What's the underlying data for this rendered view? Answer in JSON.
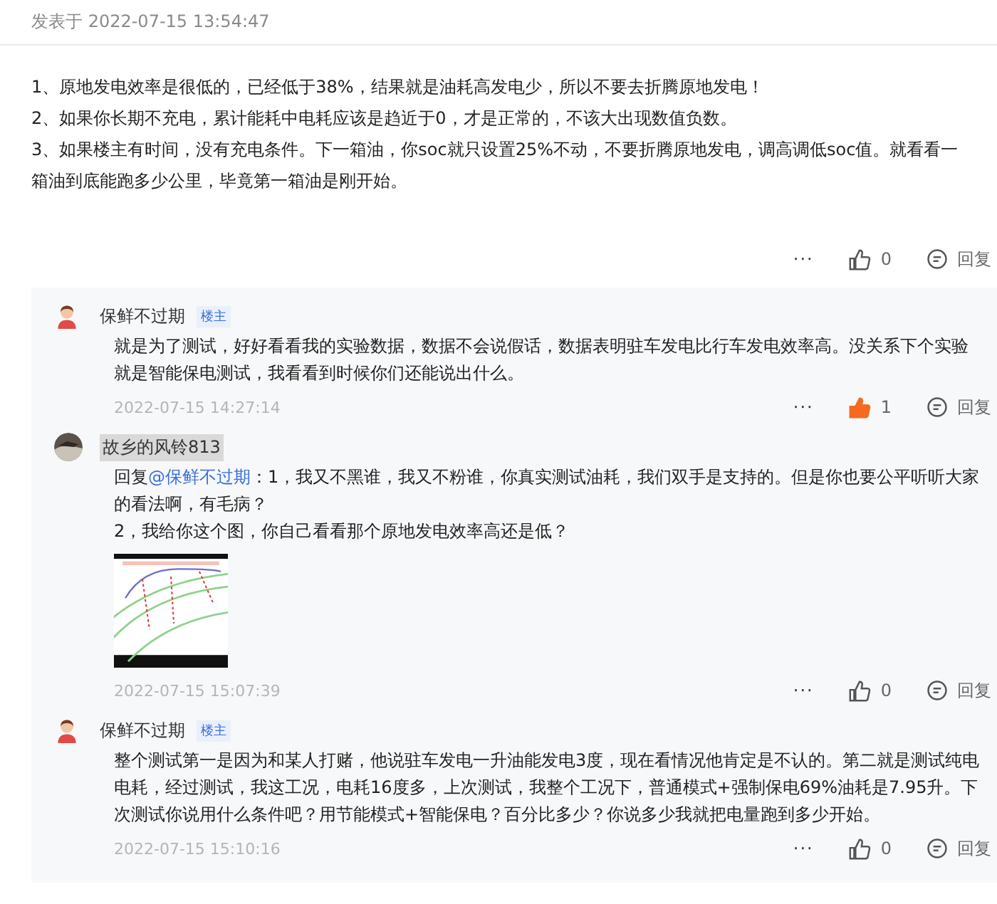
{
  "post": {
    "posted_at": "发表于 2022-07-15 13:54:47",
    "paragraphs": [
      "1、原地发电效率是很低的，已经低于38%，结果就是油耗高发电少，所以不要去折腾原地发电！",
      "2、如果你长期不充电，累计能耗中电耗应该是趋近于0，才是正常的，不该大出现数值负数。",
      "3、如果楼主有时间，没有充电条件。下一箱油，你soc就只设置25%不动，不要折腾原地发电，调高调低soc值。就看看一箱油到底能跑多少公里，毕竟第一箱油是刚开始。"
    ],
    "actions": {
      "more": "···",
      "likes": "0",
      "liked": false,
      "reply": "回复"
    }
  },
  "comments": [
    {
      "author": "保鲜不过期",
      "author_highlighted": false,
      "badge": "楼主",
      "avatar": {
        "kind": "cartoon"
      },
      "paragraphs": [
        "就是为了测试，好好看看我的实验数据，数据不会说假话，数据表明驻车发电比行车发电效率高。没关系下个实验就是智能保电测试，我看看到时候你们还能说出什么。"
      ],
      "time": "2022-07-15 14:27:14",
      "more": "···",
      "likes": "1",
      "liked": true,
      "reply": "回复"
    },
    {
      "author": "故乡的风铃813",
      "author_highlighted": true,
      "reply_prefix": "回复",
      "mention": "@保鲜不过期",
      "paragraphs": [
        "：1，我又不黑谁，我又不粉谁，你真实测试油耗，我们双手是支持的。但是你也要公平听听大家的看法啊，有毛病？",
        "2，我给你这个图，你自己看看那个原地发电效率高还是低？"
      ],
      "time": "2022-07-15 15:07:39",
      "more": "···",
      "likes": "0",
      "liked": false,
      "reply": "回复"
    },
    {
      "author": "保鲜不过期",
      "author_highlighted": false,
      "badge": "楼主",
      "avatar": {
        "kind": "cartoon"
      },
      "paragraphs": [
        "整个测试第一是因为和某人打赌，他说驻车发电一升油能发电3度，现在看情况他肯定是不认的。第二就是测试纯电电耗，经过测试，我这工况，电耗16度多，上次测试，我整个工况下，普通模式+强制保电69%油耗是7.95升。下次测试你说用什么条件吧？用节能模式+智能保电？百分比多少？你说多少我就把电量跑到多少开始。"
      ],
      "time": "2022-07-15 15:10:16",
      "more": "···",
      "likes": "0",
      "liked": false,
      "reply": "回复"
    }
  ]
}
